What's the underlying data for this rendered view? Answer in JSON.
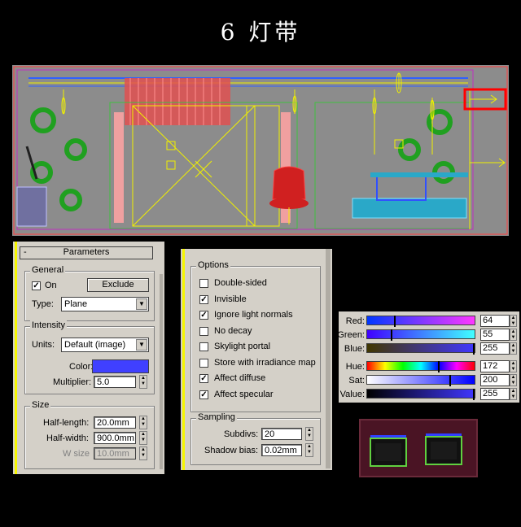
{
  "title": "6 灯带",
  "parameters_panel": {
    "rollout_toggle": "-",
    "rollout_title": "Parameters",
    "general": {
      "label": "General",
      "on_label": "On",
      "on_checked": true,
      "exclude_label": "Exclude",
      "type_label": "Type:",
      "type_value": "Plane"
    },
    "intensity": {
      "label": "Intensity",
      "units_label": "Units:",
      "units_value": "Default (image)",
      "color_label": "Color:",
      "color_value": "#4040ff",
      "multiplier_label": "Multiplier:",
      "multiplier_value": "5.0"
    },
    "size": {
      "label": "Size",
      "half_length_label": "Half-length:",
      "half_length_value": "20.0mm",
      "half_width_label": "Half-width:",
      "half_width_value": "900.0mm",
      "w_size_label": "W size",
      "w_size_value": "10.0mm"
    }
  },
  "options_panel": {
    "options_label": "Options",
    "items": [
      {
        "label": "Double-sided",
        "checked": false
      },
      {
        "label": "Invisible",
        "checked": true
      },
      {
        "label": "Ignore light normals",
        "checked": true
      },
      {
        "label": "No decay",
        "checked": false
      },
      {
        "label": "Skylight portal",
        "checked": false
      },
      {
        "label": "Store with irradiance map",
        "checked": false
      },
      {
        "label": "Affect diffuse",
        "checked": true
      },
      {
        "label": "Affect specular",
        "checked": true
      }
    ],
    "sampling_label": "Sampling",
    "subdivs_label": "Subdivs:",
    "subdivs_value": "20",
    "shadow_bias_label": "Shadow bias:",
    "shadow_bias_value": "0.02mm"
  },
  "color_selector": {
    "rows": [
      {
        "label": "Red:",
        "value": "64",
        "level": 0.25
      },
      {
        "label": "Green:",
        "value": "55",
        "level": 0.22
      },
      {
        "label": "Blue:",
        "value": "255",
        "level": 1.0
      },
      {
        "label": "Hue:",
        "value": "172",
        "level": 0.67
      },
      {
        "label": "Sat:",
        "value": "200",
        "level": 0.78
      },
      {
        "label": "Value:",
        "value": "255",
        "level": 1.0
      }
    ]
  },
  "colors": {
    "panel_bg": "#d4d0c8",
    "viewport_bg": "#8c8c8c",
    "accent_yellow": "#f6f600",
    "highlight_red": "#ff0000",
    "light_blue": "#4040ff"
  }
}
